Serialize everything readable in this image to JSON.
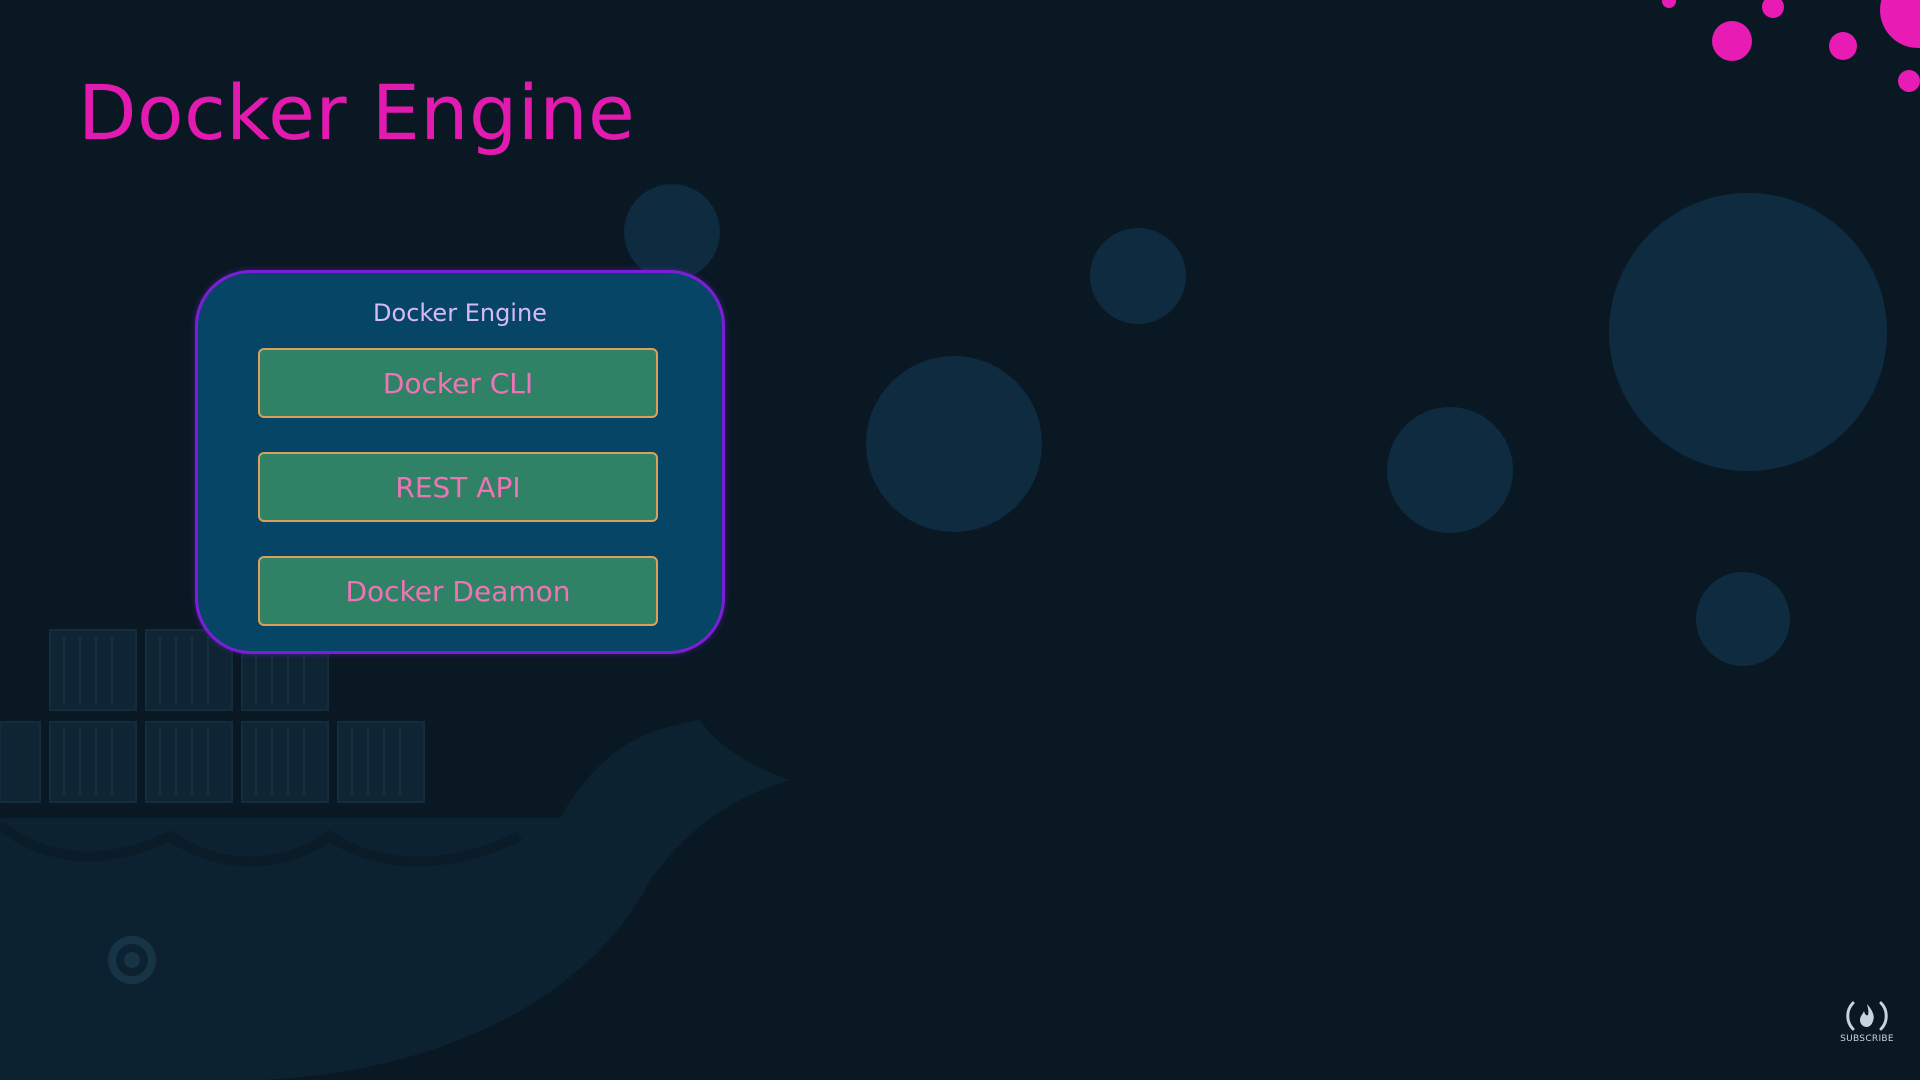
{
  "slide": {
    "title": "Docker Engine",
    "title_color": "#e21ab0",
    "background_color": "#0a1824"
  },
  "diagram": {
    "container_label": "Docker Engine",
    "container_fill": "#074567",
    "container_border": "#7a1fd6",
    "components": [
      {
        "label": "Docker CLI"
      },
      {
        "label": "REST API"
      },
      {
        "label": "Docker Deamon"
      }
    ],
    "component_fill": "#2f8265",
    "component_border": "#d9a05a",
    "component_text_color": "#ef74b6"
  },
  "branding": {
    "logo_icon": "freecodecamp-flame-icon",
    "subscribe_label": "SUBSCRIBE"
  }
}
